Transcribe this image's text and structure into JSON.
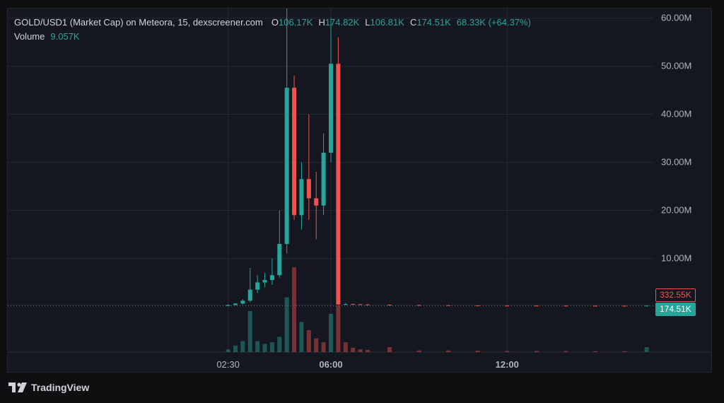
{
  "legend": {
    "symbol": "GOLD/USD1 (Market Cap) on Meteora, 15, dexscreener.com",
    "open_label": "O",
    "open": "106.17K",
    "high_label": "H",
    "high": "174.82K",
    "low_label": "L",
    "low": "106.81K",
    "close_label": "C",
    "close": "174.51K",
    "change": "68.33K (+64.37%)",
    "volume_label": "Volume",
    "volume": "9.057K"
  },
  "price_labels": {
    "reference": "332.55K",
    "last": "174.51K"
  },
  "brand": {
    "name": "TradingView",
    "icon": "tradingview-logo-icon"
  },
  "colors": {
    "up": "#26a69a",
    "down": "#ef5350",
    "background": "#151720",
    "grid": "#242733",
    "axis_text": "#b2b5be"
  },
  "chart_data": {
    "type": "candlestick",
    "title": "",
    "ylabel": "",
    "xlabel": "",
    "y_ticks": [
      "10.00M",
      "20.00M",
      "30.00M",
      "40.00M",
      "50.00M",
      "60.00M"
    ],
    "y_tick_values": [
      10000000,
      20000000,
      30000000,
      40000000,
      50000000,
      60000000
    ],
    "x_ticks": [
      "02:30",
      "06:00",
      "12:00"
    ],
    "x_tick_times": [
      "02:30",
      "06:00",
      "12:00"
    ],
    "ylim": [
      -9500000,
      62000000
    ],
    "x_range": [
      "19:00",
      "17:00"
    ],
    "interval_minutes": 15,
    "grid": true,
    "last_price": 174510,
    "candles": [
      {
        "t": "02:30",
        "o": 100000,
        "h": 400000,
        "l": 80000,
        "c": 300000
      },
      {
        "t": "02:45",
        "o": 300000,
        "h": 700000,
        "l": 200000,
        "c": 600000
      },
      {
        "t": "03:00",
        "o": 600000,
        "h": 1500000,
        "l": 400000,
        "c": 1200000
      },
      {
        "t": "03:15",
        "o": 1200000,
        "h": 8000000,
        "l": 900000,
        "c": 3500000
      },
      {
        "t": "03:30",
        "o": 3500000,
        "h": 6500000,
        "l": 2800000,
        "c": 5000000
      },
      {
        "t": "03:45",
        "o": 5000000,
        "h": 7000000,
        "l": 4000000,
        "c": 5500000
      },
      {
        "t": "04:00",
        "o": 5500000,
        "h": 10000000,
        "l": 4500000,
        "c": 6500000
      },
      {
        "t": "04:15",
        "o": 6500000,
        "h": 20000000,
        "l": 6000000,
        "c": 13000000
      },
      {
        "t": "04:30",
        "o": 13000000,
        "h": 66000000,
        "l": 11000000,
        "c": 45500000
      },
      {
        "t": "04:45",
        "o": 45500000,
        "h": 48000000,
        "l": 18000000,
        "c": 19000000
      },
      {
        "t": "05:00",
        "o": 19000000,
        "h": 30000000,
        "l": 16000000,
        "c": 26500000
      },
      {
        "t": "05:15",
        "o": 26500000,
        "h": 40000000,
        "l": 18000000,
        "c": 22500000
      },
      {
        "t": "05:30",
        "o": 22500000,
        "h": 28000000,
        "l": 14000000,
        "c": 21000000
      },
      {
        "t": "05:45",
        "o": 21000000,
        "h": 36000000,
        "l": 19000000,
        "c": 32000000
      },
      {
        "t": "06:00",
        "o": 32000000,
        "h": 60000000,
        "l": 30000000,
        "c": 50500000
      },
      {
        "t": "06:15",
        "o": 50500000,
        "h": 56000000,
        "l": 300000,
        "c": 400000
      },
      {
        "t": "06:30",
        "o": 400000,
        "h": 700000,
        "l": 300000,
        "c": 500000
      },
      {
        "t": "06:45",
        "o": 500000,
        "h": 600000,
        "l": 350000,
        "c": 450000
      },
      {
        "t": "07:00",
        "o": 450000,
        "h": 550000,
        "l": 350000,
        "c": 400000
      },
      {
        "t": "07:15",
        "o": 400000,
        "h": 500000,
        "l": 300000,
        "c": 350000
      },
      {
        "t": "08:00",
        "o": 350000,
        "h": 450000,
        "l": 200000,
        "c": 300000
      },
      {
        "t": "09:00",
        "o": 300000,
        "h": 350000,
        "l": 200000,
        "c": 250000
      },
      {
        "t": "10:00",
        "o": 250000,
        "h": 300000,
        "l": 180000,
        "c": 200000
      },
      {
        "t": "11:00",
        "o": 200000,
        "h": 250000,
        "l": 150000,
        "c": 180000
      },
      {
        "t": "12:00",
        "o": 180000,
        "h": 220000,
        "l": 140000,
        "c": 170000
      },
      {
        "t": "13:00",
        "o": 170000,
        "h": 210000,
        "l": 130000,
        "c": 160000
      },
      {
        "t": "14:00",
        "o": 160000,
        "h": 200000,
        "l": 120000,
        "c": 150000
      },
      {
        "t": "15:00",
        "o": 150000,
        "h": 190000,
        "l": 110000,
        "c": 140000
      },
      {
        "t": "16:00",
        "o": 140000,
        "h": 180000,
        "l": 106170,
        "c": 106170
      },
      {
        "t": "16:45",
        "o": 106170,
        "h": 174820,
        "l": 106810,
        "c": 174510
      }
    ],
    "volume": [
      {
        "t": "02:30",
        "v": 5000,
        "dir": "up"
      },
      {
        "t": "02:45",
        "v": 12000,
        "dir": "up"
      },
      {
        "t": "03:00",
        "v": 20000,
        "dir": "up"
      },
      {
        "t": "03:15",
        "v": 75000,
        "dir": "up"
      },
      {
        "t": "03:30",
        "v": 20000,
        "dir": "up"
      },
      {
        "t": "03:45",
        "v": 15000,
        "dir": "up"
      },
      {
        "t": "04:00",
        "v": 18000,
        "dir": "up"
      },
      {
        "t": "04:15",
        "v": 28000,
        "dir": "up"
      },
      {
        "t": "04:30",
        "v": 100000,
        "dir": "up"
      },
      {
        "t": "04:45",
        "v": 155000,
        "dir": "down"
      },
      {
        "t": "05:00",
        "v": 55000,
        "dir": "up"
      },
      {
        "t": "05:15",
        "v": 40000,
        "dir": "down"
      },
      {
        "t": "05:30",
        "v": 25000,
        "dir": "down"
      },
      {
        "t": "05:45",
        "v": 18000,
        "dir": "down"
      },
      {
        "t": "06:00",
        "v": 70000,
        "dir": "up"
      },
      {
        "t": "06:15",
        "v": 85000,
        "dir": "down"
      },
      {
        "t": "06:30",
        "v": 18000,
        "dir": "down"
      },
      {
        "t": "06:45",
        "v": 8000,
        "dir": "down"
      },
      {
        "t": "07:00",
        "v": 5000,
        "dir": "down"
      },
      {
        "t": "07:15",
        "v": 4000,
        "dir": "down"
      },
      {
        "t": "08:00",
        "v": 9000,
        "dir": "down"
      },
      {
        "t": "09:00",
        "v": 3000,
        "dir": "down"
      },
      {
        "t": "10:00",
        "v": 3000,
        "dir": "down"
      },
      {
        "t": "11:00",
        "v": 2500,
        "dir": "down"
      },
      {
        "t": "12:00",
        "v": 2000,
        "dir": "down"
      },
      {
        "t": "13:00",
        "v": 2000,
        "dir": "down"
      },
      {
        "t": "14:00",
        "v": 2000,
        "dir": "down"
      },
      {
        "t": "15:00",
        "v": 1500,
        "dir": "down"
      },
      {
        "t": "16:00",
        "v": 1500,
        "dir": "down"
      },
      {
        "t": "16:45",
        "v": 9057,
        "dir": "up"
      }
    ]
  }
}
